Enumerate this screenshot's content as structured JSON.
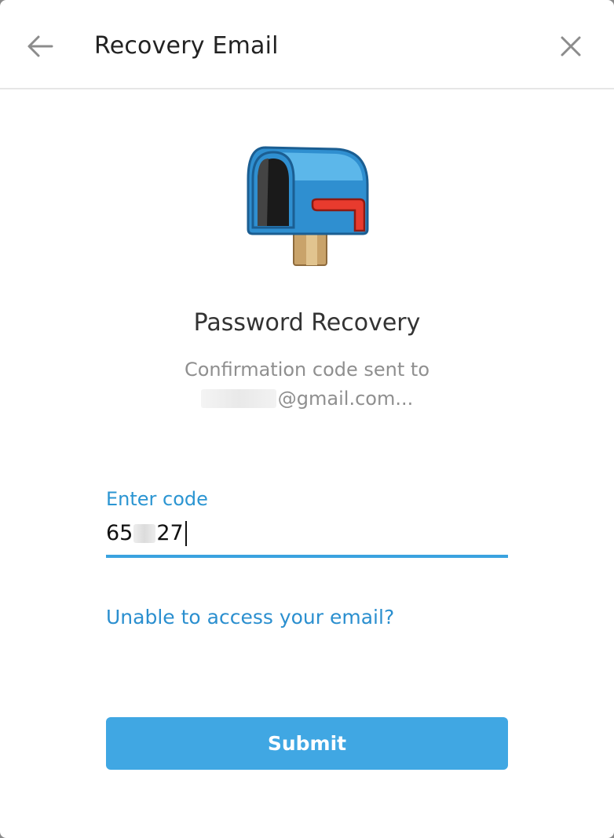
{
  "header": {
    "title": "Recovery Email",
    "back_icon": "arrow-left-icon",
    "close_icon": "close-icon"
  },
  "illustration": {
    "icon": "mailbox-icon"
  },
  "main": {
    "title": "Password Recovery",
    "description_line1": "Confirmation code sent to",
    "email_suffix": "@gmail.com..."
  },
  "code_field": {
    "label": "Enter code",
    "value_prefix": "65",
    "value_suffix": "27"
  },
  "link": {
    "label": "Unable to access your email?"
  },
  "submit": {
    "label": "Submit"
  },
  "colors": {
    "accent": "#40a7e3",
    "link": "#2b8fcf",
    "label": "#2b95d2"
  }
}
